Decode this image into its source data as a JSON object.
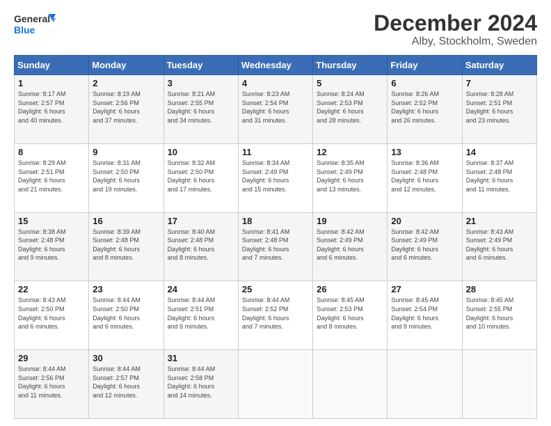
{
  "logo": {
    "line1": "General",
    "line2": "Blue"
  },
  "title": "December 2024",
  "subtitle": "Alby, Stockholm, Sweden",
  "days_of_week": [
    "Sunday",
    "Monday",
    "Tuesday",
    "Wednesday",
    "Thursday",
    "Friday",
    "Saturday"
  ],
  "weeks": [
    [
      {
        "day": "1",
        "sunrise": "8:17 AM",
        "sunset": "2:57 PM",
        "daylight": "6 hours and 40 minutes."
      },
      {
        "day": "2",
        "sunrise": "8:19 AM",
        "sunset": "2:56 PM",
        "daylight": "6 hours and 37 minutes."
      },
      {
        "day": "3",
        "sunrise": "8:21 AM",
        "sunset": "2:55 PM",
        "daylight": "6 hours and 34 minutes."
      },
      {
        "day": "4",
        "sunrise": "8:23 AM",
        "sunset": "2:54 PM",
        "daylight": "6 hours and 31 minutes."
      },
      {
        "day": "5",
        "sunrise": "8:24 AM",
        "sunset": "2:53 PM",
        "daylight": "6 hours and 28 minutes."
      },
      {
        "day": "6",
        "sunrise": "8:26 AM",
        "sunset": "2:52 PM",
        "daylight": "6 hours and 26 minutes."
      },
      {
        "day": "7",
        "sunrise": "8:28 AM",
        "sunset": "2:51 PM",
        "daylight": "6 hours and 23 minutes."
      }
    ],
    [
      {
        "day": "8",
        "sunrise": "8:29 AM",
        "sunset": "2:51 PM",
        "daylight": "6 hours and 21 minutes."
      },
      {
        "day": "9",
        "sunrise": "8:31 AM",
        "sunset": "2:50 PM",
        "daylight": "6 hours and 19 minutes."
      },
      {
        "day": "10",
        "sunrise": "8:32 AM",
        "sunset": "2:50 PM",
        "daylight": "6 hours and 17 minutes."
      },
      {
        "day": "11",
        "sunrise": "8:34 AM",
        "sunset": "2:49 PM",
        "daylight": "6 hours and 15 minutes."
      },
      {
        "day": "12",
        "sunrise": "8:35 AM",
        "sunset": "2:49 PM",
        "daylight": "6 hours and 13 minutes."
      },
      {
        "day": "13",
        "sunrise": "8:36 AM",
        "sunset": "2:48 PM",
        "daylight": "6 hours and 12 minutes."
      },
      {
        "day": "14",
        "sunrise": "8:37 AM",
        "sunset": "2:48 PM",
        "daylight": "6 hours and 11 minutes."
      }
    ],
    [
      {
        "day": "15",
        "sunrise": "8:38 AM",
        "sunset": "2:48 PM",
        "daylight": "6 hours and 9 minutes."
      },
      {
        "day": "16",
        "sunrise": "8:39 AM",
        "sunset": "2:48 PM",
        "daylight": "6 hours and 8 minutes."
      },
      {
        "day": "17",
        "sunrise": "8:40 AM",
        "sunset": "2:48 PM",
        "daylight": "6 hours and 8 minutes."
      },
      {
        "day": "18",
        "sunrise": "8:41 AM",
        "sunset": "2:48 PM",
        "daylight": "6 hours and 7 minutes."
      },
      {
        "day": "19",
        "sunrise": "8:42 AM",
        "sunset": "2:49 PM",
        "daylight": "6 hours and 6 minutes."
      },
      {
        "day": "20",
        "sunrise": "8:42 AM",
        "sunset": "2:49 PM",
        "daylight": "6 hours and 6 minutes."
      },
      {
        "day": "21",
        "sunrise": "8:43 AM",
        "sunset": "2:49 PM",
        "daylight": "6 hours and 6 minutes."
      }
    ],
    [
      {
        "day": "22",
        "sunrise": "8:43 AM",
        "sunset": "2:50 PM",
        "daylight": "6 hours and 6 minutes."
      },
      {
        "day": "23",
        "sunrise": "8:44 AM",
        "sunset": "2:50 PM",
        "daylight": "6 hours and 6 minutes."
      },
      {
        "day": "24",
        "sunrise": "8:44 AM",
        "sunset": "2:51 PM",
        "daylight": "6 hours and 6 minutes."
      },
      {
        "day": "25",
        "sunrise": "8:44 AM",
        "sunset": "2:52 PM",
        "daylight": "6 hours and 7 minutes."
      },
      {
        "day": "26",
        "sunrise": "8:45 AM",
        "sunset": "2:53 PM",
        "daylight": "6 hours and 8 minutes."
      },
      {
        "day": "27",
        "sunrise": "8:45 AM",
        "sunset": "2:54 PM",
        "daylight": "6 hours and 9 minutes."
      },
      {
        "day": "28",
        "sunrise": "8:45 AM",
        "sunset": "2:55 PM",
        "daylight": "6 hours and 10 minutes."
      }
    ],
    [
      {
        "day": "29",
        "sunrise": "8:44 AM",
        "sunset": "2:56 PM",
        "daylight": "6 hours and 11 minutes."
      },
      {
        "day": "30",
        "sunrise": "8:44 AM",
        "sunset": "2:57 PM",
        "daylight": "6 hours and 12 minutes."
      },
      {
        "day": "31",
        "sunrise": "8:44 AM",
        "sunset": "2:58 PM",
        "daylight": "6 hours and 14 minutes."
      },
      null,
      null,
      null,
      null
    ]
  ]
}
